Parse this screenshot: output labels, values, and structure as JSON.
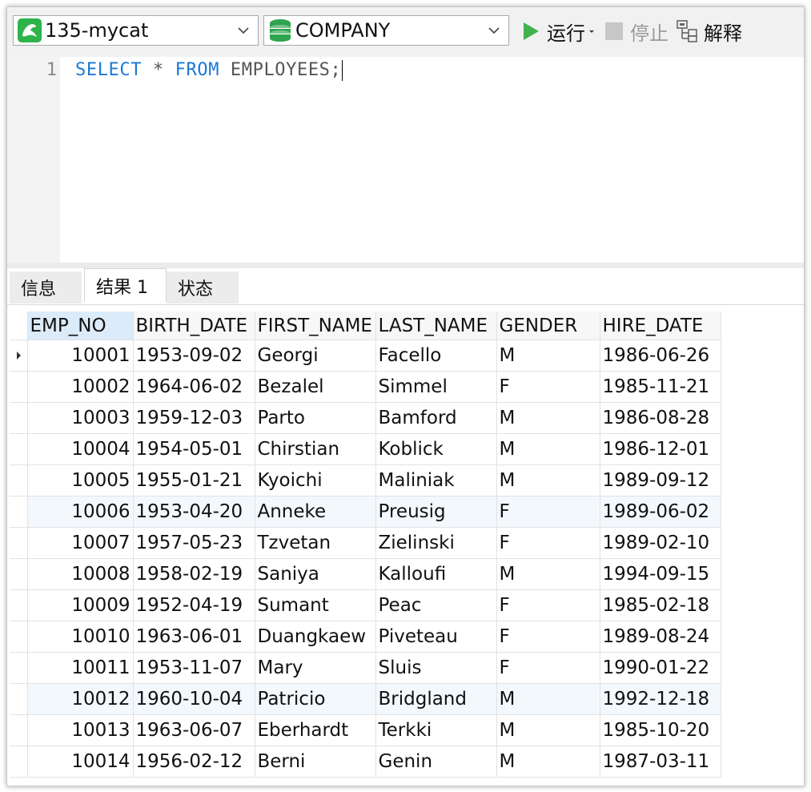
{
  "toolbar": {
    "connection": "135-mycat",
    "database": "COMPANY",
    "run_label": "运行",
    "stop_label": "停止",
    "explain_label": "解释"
  },
  "editor": {
    "line_number": "1",
    "sql_kw1": "SELECT",
    "sql_star": "*",
    "sql_kw2": "FROM",
    "sql_table": "EMPLOYEES;"
  },
  "tabs": [
    {
      "label": "信息"
    },
    {
      "label": "结果 1"
    },
    {
      "label": "状态"
    }
  ],
  "grid": {
    "columns": [
      "EMP_NO",
      "BIRTH_DATE",
      "FIRST_NAME",
      "LAST_NAME",
      "GENDER",
      "HIRE_DATE"
    ],
    "rows": [
      [
        "10001",
        "1953-09-02",
        "Georgi",
        "Facello",
        "M",
        "1986-06-26"
      ],
      [
        "10002",
        "1964-06-02",
        "Bezalel",
        "Simmel",
        "F",
        "1985-11-21"
      ],
      [
        "10003",
        "1959-12-03",
        "Parto",
        "Bamford",
        "M",
        "1986-08-28"
      ],
      [
        "10004",
        "1954-05-01",
        "Chirstian",
        "Koblick",
        "M",
        "1986-12-01"
      ],
      [
        "10005",
        "1955-01-21",
        "Kyoichi",
        "Maliniak",
        "M",
        "1989-09-12"
      ],
      [
        "10006",
        "1953-04-20",
        "Anneke",
        "Preusig",
        "F",
        "1989-06-02"
      ],
      [
        "10007",
        "1957-05-23",
        "Tzvetan",
        "Zielinski",
        "F",
        "1989-02-10"
      ],
      [
        "10008",
        "1958-02-19",
        "Saniya",
        "Kalloufi",
        "M",
        "1994-09-15"
      ],
      [
        "10009",
        "1952-04-19",
        "Sumant",
        "Peac",
        "F",
        "1985-02-18"
      ],
      [
        "10010",
        "1963-06-01",
        "Duangkaew",
        "Piveteau",
        "F",
        "1989-08-24"
      ],
      [
        "10011",
        "1953-11-07",
        "Mary",
        "Sluis",
        "F",
        "1990-01-22"
      ],
      [
        "10012",
        "1960-10-04",
        "Patricio",
        "Bridgland",
        "M",
        "1992-12-18"
      ],
      [
        "10013",
        "1963-06-07",
        "Eberhardt",
        "Terkki",
        "M",
        "1985-10-20"
      ],
      [
        "10014",
        "1956-02-12",
        "Berni",
        "Genin",
        "M",
        "1987-03-11"
      ]
    ]
  },
  "colors": {
    "keyword": "#1a7ad6",
    "run_green": "#3fb34f",
    "db_green": "#2ea44f",
    "selected_header": "#dcebfa"
  },
  "icons": [
    "mysql-dolphin-icon",
    "database-icon",
    "chevron-down-icon",
    "play-icon",
    "stop-icon",
    "explain-icon",
    "row-pointer-icon"
  ]
}
